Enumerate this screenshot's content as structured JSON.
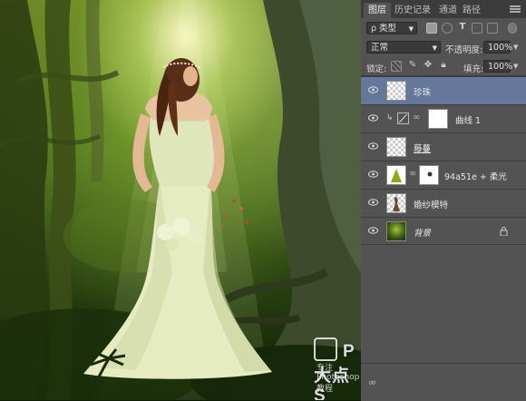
{
  "watermarks": {
    "brand": "P大点S",
    "sub": "专注Photoshop教程"
  },
  "panel": {
    "tabs": [
      "图层",
      "历史记录",
      "通道",
      "路径"
    ],
    "filter_label": "ρ 类型",
    "blend_mode": "正常",
    "opacity_label": "不透明度:",
    "opacity_value": "100%",
    "lock_label": "锁定:",
    "fill_label": "填充:",
    "fill_value": "100%",
    "layers": [
      {
        "name": "珍珠",
        "thumb": "transparent",
        "selected": true
      },
      {
        "name": "曲线 1",
        "thumb": "adjustment",
        "selected": false
      },
      {
        "name": "藤蔓",
        "thumb": "transparent",
        "selected": false
      },
      {
        "name": "94a51e + 柔光",
        "thumb": "green",
        "selected": false
      },
      {
        "name": "婚纱模特",
        "thumb": "model",
        "selected": false
      },
      {
        "name": "背景",
        "thumb": "dark",
        "selected": false,
        "locked": true
      }
    ]
  },
  "colors": {
    "selected_layer": "#65789a",
    "panel_bg": "#535353",
    "fill_layer_color": "#94a51e"
  }
}
